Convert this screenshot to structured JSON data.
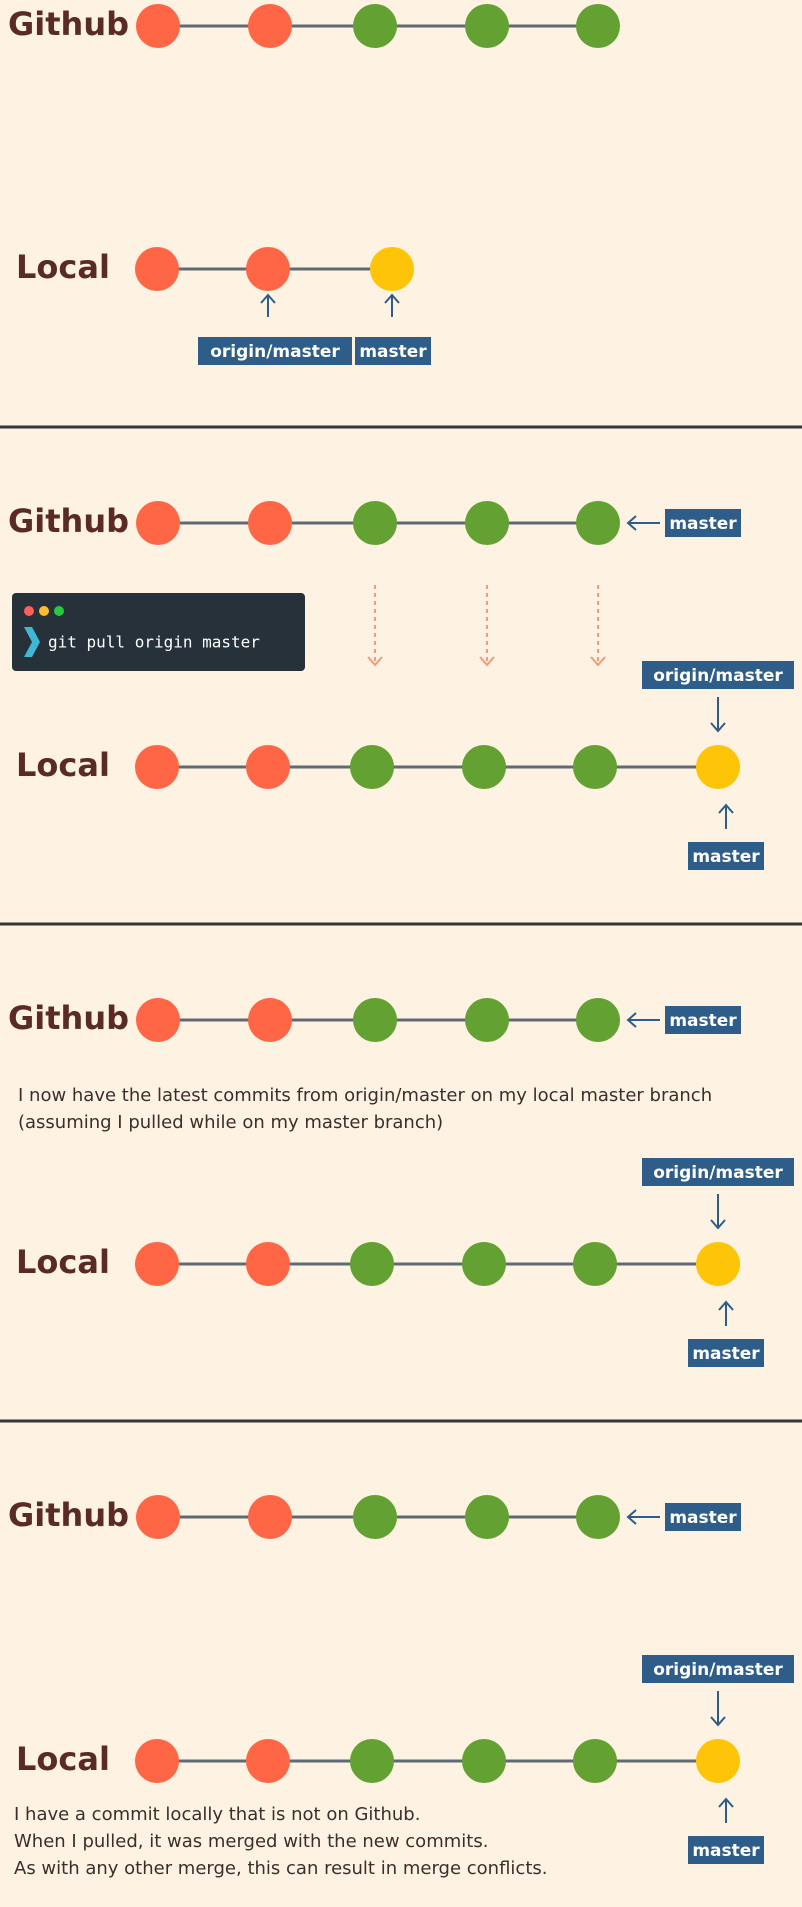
{
  "colors": {
    "background": "#fef2e2",
    "old_commit": "#fe6645",
    "new_commit": "#63a132",
    "local_commit": "#fec508",
    "line": "#5f6a74",
    "tag": "#2e5d8a",
    "arrow": "#2e5d8a",
    "pull_arrow": "#f59b77",
    "divider": "#33373e",
    "terminal_bg": "#273139",
    "terminal_prompt": "#3fb8d6",
    "label": "#5a2a27"
  },
  "panels": [
    {
      "github_label": "Github",
      "local_label": "Local",
      "github_commits": [
        "old",
        "old",
        "new",
        "new",
        "new"
      ],
      "local_commits": [
        "old",
        "old",
        "local"
      ],
      "github_master_tag": "",
      "local_tags": {
        "origin_master": "origin/master",
        "master": "master"
      }
    },
    {
      "github_label": "Github",
      "local_label": "Local",
      "github_commits": [
        "old",
        "old",
        "new",
        "new",
        "new"
      ],
      "local_commits": [
        "old",
        "old",
        "new",
        "new",
        "new",
        "local"
      ],
      "github_master_tag": "master",
      "local_tags": {
        "origin_master": "origin/master",
        "master": "master"
      },
      "terminal": {
        "command": "git pull origin master",
        "dots": [
          "#ff5f56",
          "#ffbd2e",
          "#27c93f"
        ]
      }
    },
    {
      "github_label": "Github",
      "local_label": "Local",
      "github_commits": [
        "old",
        "old",
        "new",
        "new",
        "new"
      ],
      "local_commits": [
        "old",
        "old",
        "new",
        "new",
        "new",
        "local"
      ],
      "github_master_tag": "master",
      "local_tags": {
        "origin_master": "origin/master",
        "master": "master"
      },
      "note_lines": [
        "I now have the latest commits from origin/master on my local master branch",
        "(assuming I pulled while on my master branch)"
      ]
    },
    {
      "github_label": "Github",
      "local_label": "Local",
      "github_commits": [
        "old",
        "old",
        "new",
        "new",
        "new"
      ],
      "local_commits": [
        "old",
        "old",
        "new",
        "new",
        "new",
        "local"
      ],
      "github_master_tag": "master",
      "local_tags": {
        "origin_master": "origin/master",
        "master": "master"
      },
      "note_lines": [
        "I have a commit locally that is not on Github.",
        "When I pulled, it was merged with the new commits.",
        "As with any other merge, this can result in merge conflicts."
      ]
    }
  ]
}
